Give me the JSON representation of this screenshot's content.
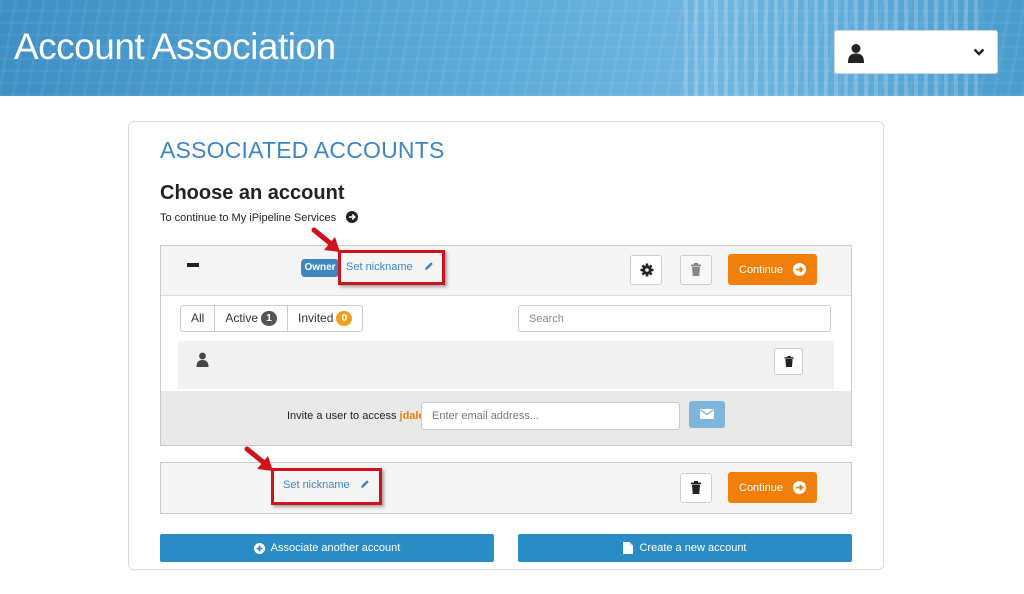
{
  "header": {
    "title": "Account Association",
    "user_dropdown": {
      "icon": "user-icon",
      "caret": "chevron-down-icon"
    }
  },
  "main": {
    "section_title": "ASSOCIATED ACCOUNTS",
    "heading": "Choose an account",
    "subtext": "To continue to My iPipeline Services",
    "accounts": [
      {
        "badge": "Owner",
        "nickname_link": "Set nickname",
        "continue_label": "Continue",
        "expanded": true,
        "filters": [
          {
            "label": "All",
            "count": null
          },
          {
            "label": "Active",
            "count": "1"
          },
          {
            "label": "Invited",
            "count": "0"
          }
        ],
        "search_placeholder": "Search",
        "invite": {
          "prefix": "Invite a user to access",
          "username": "jdale",
          "email_placeholder": "Enter email address..."
        }
      },
      {
        "nickname_link": "Set nickname",
        "continue_label": "Continue",
        "expanded": false
      }
    ],
    "associate_button": "Associate another account",
    "create_button": "Create a new account"
  },
  "colors": {
    "accent": "#3d86c2",
    "continue": "#f07f0b",
    "primary_button": "#2a8cc5",
    "annotation_red": "#d0121b"
  }
}
